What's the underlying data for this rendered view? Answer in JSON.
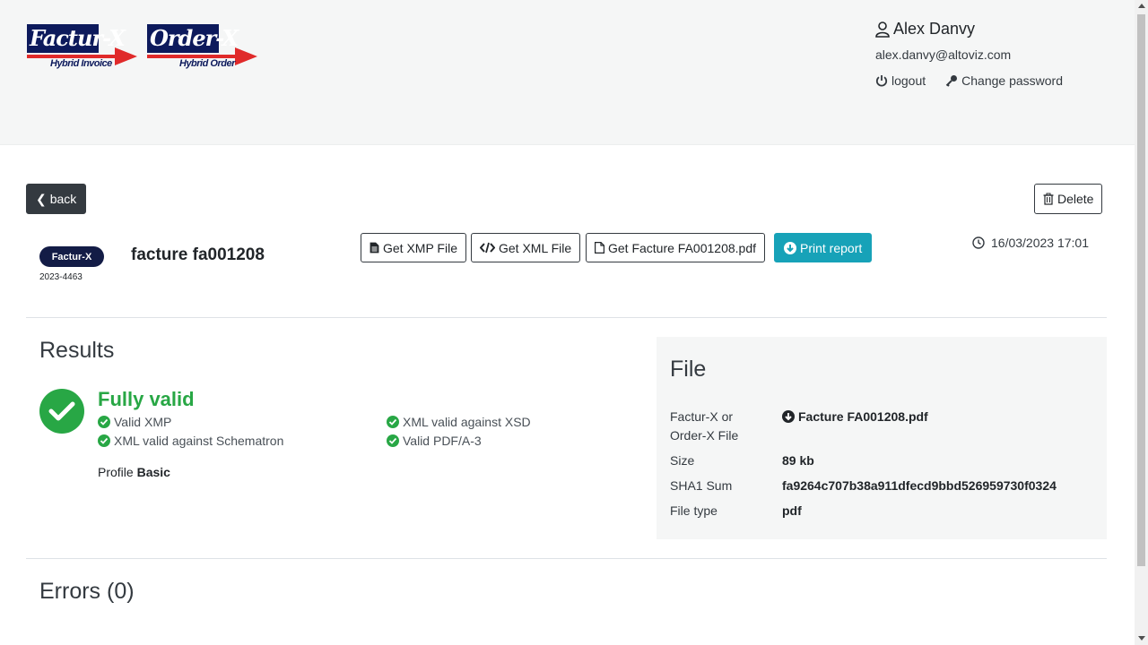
{
  "logos": {
    "facturx": {
      "main": "Factur-X",
      "sub": "Hybrid Invoice"
    },
    "orderx": {
      "main": "Order-X",
      "sub": "Hybrid Order"
    }
  },
  "user": {
    "name": "Alex Danvy",
    "email": "alex.danvy@altoviz.com",
    "logout_label": "logout",
    "change_password_label": "Change password"
  },
  "toolbar": {
    "back_label": "back",
    "delete_label": "Delete"
  },
  "document": {
    "badge": "Factur-X",
    "reference": "2023-4463",
    "title": "facture fa001208",
    "datetime": "16/03/2023 17:01"
  },
  "actions": {
    "get_xmp": "Get XMP File",
    "get_xml": "Get XML File",
    "get_pdf": "Get Facture FA001208.pdf",
    "print_report": "Print report"
  },
  "results": {
    "title": "Results",
    "status": "Fully valid",
    "checks": [
      "Valid XMP",
      "XML valid against Schematron",
      "XML valid against XSD",
      "Valid PDF/A-3"
    ],
    "profile_label": "Profile",
    "profile_value": "Basic"
  },
  "file": {
    "title": "File",
    "rows": [
      {
        "label": "Factur-X or Order-X File",
        "value": "Facture FA001208.pdf"
      },
      {
        "label": "Size",
        "value": "89 kb"
      },
      {
        "label": "SHA1 Sum",
        "value": "fa9264c707b38a911dfecd9bbd526959730f0324"
      },
      {
        "label": "File type",
        "value": "pdf"
      }
    ]
  },
  "errors": {
    "title": "Errors (0)"
  },
  "colors": {
    "success": "#28a745",
    "info": "#17a2b8",
    "dark": "#343a40",
    "badge": "#131c46",
    "logo_red": "#e02a2a"
  }
}
